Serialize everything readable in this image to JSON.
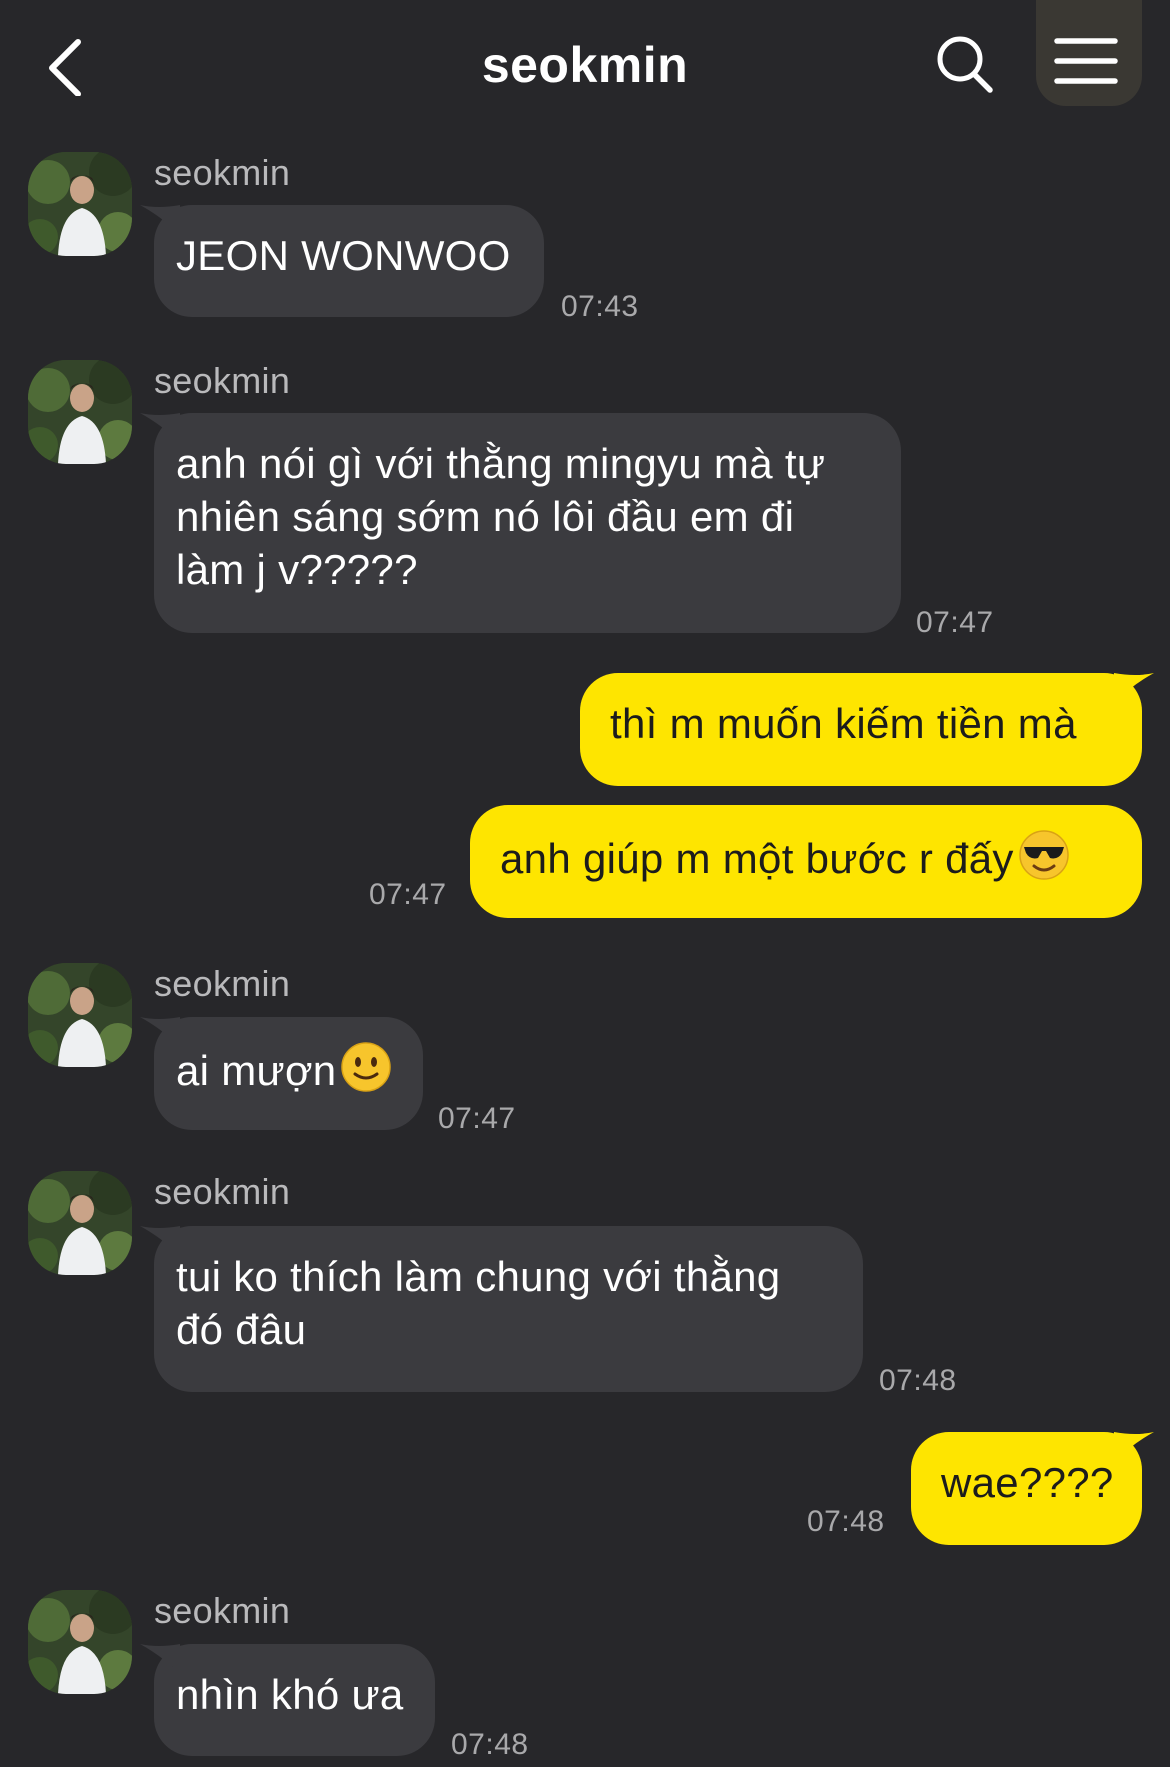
{
  "header": {
    "title": "seokmin",
    "back_icon": "chevron-left-icon",
    "search_icon": "search-icon",
    "menu_icon": "hamburger-menu-icon"
  },
  "colors": {
    "background": "#27272a",
    "incoming_bubble": "#3b3b3f",
    "outgoing_bubble": "#fee500",
    "timestamp": "#a9a9ab"
  },
  "messages": [
    {
      "sender": "seokmin",
      "text": "JEON WONWOO",
      "time": "07:43"
    },
    {
      "sender": "seokmin",
      "lines": [
        "anh nói gì với thằng mingyu mà tự",
        "nhiên sáng sớm nó lôi đầu em đi",
        "làm j v?????"
      ],
      "time": "07:47"
    },
    {
      "text": "thì m muốn kiếm tiền mà"
    },
    {
      "text": "anh giúp m một bước r đấy",
      "emoji": "smiling-face-with-sunglasses",
      "time": "07:47"
    },
    {
      "sender": "seokmin",
      "text": "ai mượn",
      "emoji": "slightly-smiling-face",
      "time": "07:47"
    },
    {
      "sender": "seokmin",
      "lines": [
        "tui ko thích làm chung với thằng",
        "đó đâu"
      ],
      "time": "07:48"
    },
    {
      "text": "wae????",
      "time": "07:48"
    },
    {
      "sender": "seokmin",
      "text": "nhìn khó ưa",
      "time": "07:48"
    }
  ]
}
